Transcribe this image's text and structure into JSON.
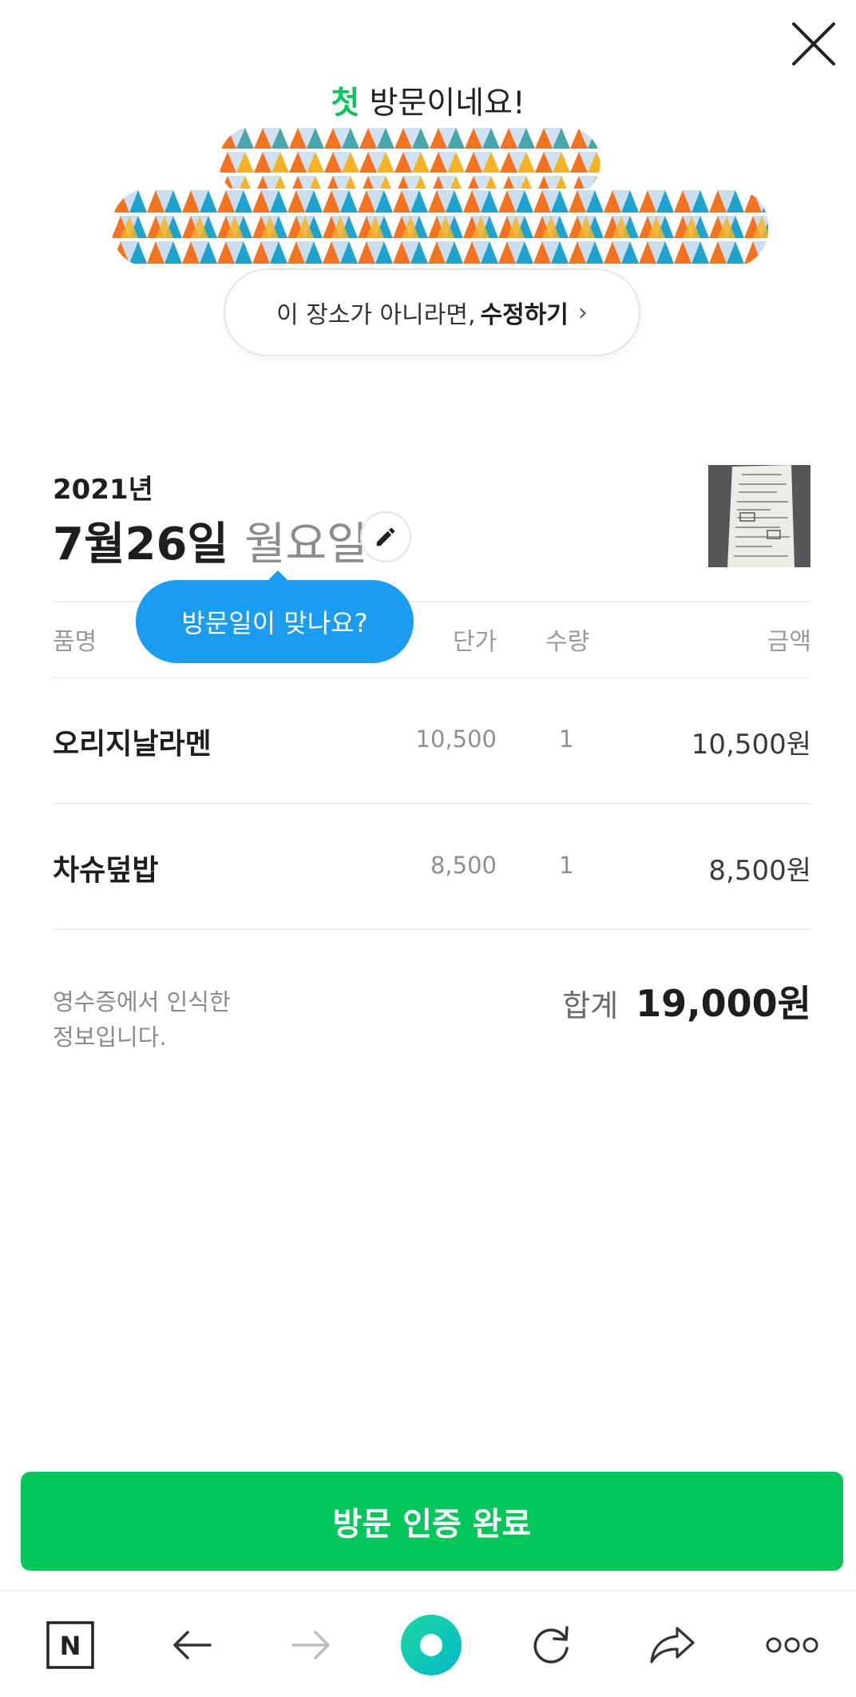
{
  "header": {
    "greeting_accent": "첫",
    "greeting_rest": " 방문이네요!",
    "place_edit_prefix": "이 장소가 아니라면,",
    "place_edit_action": "수정하기",
    "place_edit_chevron": "›"
  },
  "visit": {
    "year": "2021년",
    "month_day": "7월26일",
    "weekday": "월요일",
    "tooltip": "방문일이 맞나요?"
  },
  "table": {
    "headers": {
      "name": "품명",
      "price": "단가",
      "qty": "수량",
      "amount": "금액"
    },
    "rows": [
      {
        "name": "오리지날라멘",
        "price": "10,500",
        "qty": "1",
        "amount": "10,500원"
      },
      {
        "name": "차슈덮밥",
        "price": "8,500",
        "qty": "1",
        "amount": "8,500원"
      }
    ]
  },
  "summary": {
    "note_line1": "영수증에서 인식한",
    "note_line2": "정보입니다.",
    "total_label": "합계",
    "total_value": "19,000원"
  },
  "actions": {
    "confirm": "방문 인증 완료"
  },
  "bottom_nav": {
    "n_logo": "N",
    "icons": [
      "naver-icon",
      "back-arrow-icon",
      "forward-arrow-icon",
      "green-dot-home-icon",
      "refresh-icon",
      "share-icon",
      "more-icon"
    ]
  },
  "colors": {
    "accent_green": "#03c75a",
    "tooltip_blue": "#1a9cf0",
    "redaction_orange": "#f47321",
    "redaction_yellow": "#f5b324",
    "redaction_teal": "#1ea3cc",
    "redaction_lightblue": "#a9c8e6"
  }
}
